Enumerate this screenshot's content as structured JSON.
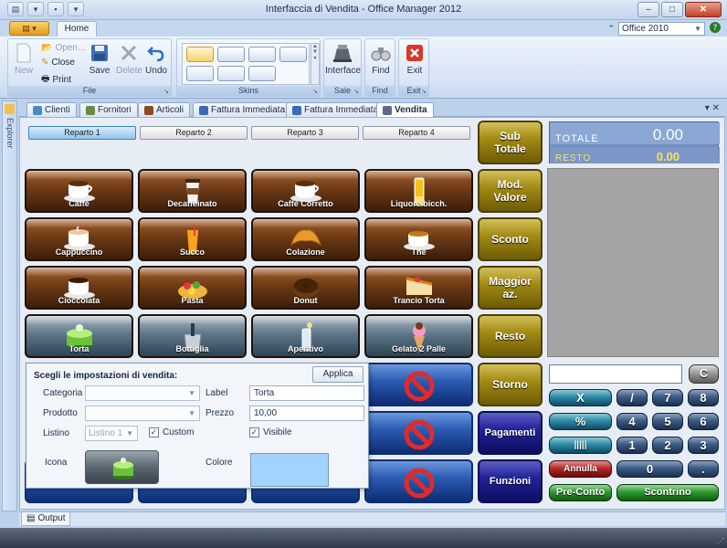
{
  "window": {
    "title": "Interfaccia di Vendita - Office Manager 2012",
    "controls": [
      "–",
      "□",
      "✕"
    ]
  },
  "ribbon": {
    "app_button": "",
    "tab": "Home",
    "skin_selected": "Office 2010",
    "groups": {
      "file": {
        "title": "File",
        "new_label": "New",
        "open_label": "Open...",
        "close_label": "Close",
        "print_label": "Print",
        "save_label": "Save",
        "delete_label": "Delete",
        "undo_label": "Undo"
      },
      "skins": {
        "title": "Skins"
      },
      "sale": {
        "title": "Sale",
        "interface_label": "Interface"
      },
      "find": {
        "title": "Find",
        "find_label": "Find"
      },
      "exit": {
        "title": "Exit",
        "exit_label": "Exit"
      }
    }
  },
  "explorer": {
    "label": "Explorer"
  },
  "doc_tabs": [
    {
      "label": "Clienti",
      "color": "#4a88c8"
    },
    {
      "label": "Fornitori",
      "color": "#6a8a40"
    },
    {
      "label": "Articoli",
      "color": "#8a4a20"
    },
    {
      "label": "Fattura Immediata",
      "color": "#3a6ab8"
    },
    {
      "label": "Fattura Immediata",
      "color": "#3a6ab8"
    },
    {
      "label": "Vendita",
      "color": "#5a6a8a",
      "active": true
    }
  ],
  "reparti": [
    "Reparto 1",
    "Reparto 2",
    "Reparto 3",
    "Reparto 4"
  ],
  "products": [
    {
      "label": "Caffè",
      "icon": "coffee-cup-icon",
      "style": "brown"
    },
    {
      "label": "Decaffeinato",
      "icon": "coffee-takeaway-icon",
      "style": "brown"
    },
    {
      "label": "Caffè Corretto",
      "icon": "coffee-cup-icon",
      "style": "brown"
    },
    {
      "label": "Liquore bicch.",
      "icon": "liqueur-glass-icon",
      "style": "brown"
    },
    {
      "label": "Cappuccino",
      "icon": "cappuccino-icon",
      "style": "brown"
    },
    {
      "label": "Succo",
      "icon": "juice-icon",
      "style": "brown"
    },
    {
      "label": "Colazione",
      "icon": "croissant-icon",
      "style": "brown"
    },
    {
      "label": "Thè",
      "icon": "tea-icon",
      "style": "brown"
    },
    {
      "label": "Cioccolata",
      "icon": "chocolate-cup-icon",
      "style": "brown"
    },
    {
      "label": "Pasta",
      "icon": "pastry-icon",
      "style": "brown"
    },
    {
      "label": "Donut",
      "icon": "donut-icon",
      "style": "brown"
    },
    {
      "label": "Trancio Torta",
      "icon": "cake-slice-icon",
      "style": "brown"
    },
    {
      "label": "Torta",
      "icon": "cake-icon",
      "style": "blue"
    },
    {
      "label": "Bottiglia",
      "icon": "bottle-bucket-icon",
      "style": "blue"
    },
    {
      "label": "Aperitivo",
      "icon": "aperitif-icon",
      "style": "blue"
    },
    {
      "label": "Gelato 2 Palle",
      "icon": "ice-cream-icon",
      "style": "blue"
    }
  ],
  "function_buttons": [
    {
      "label": "Sub\nTotale",
      "style": "gold"
    },
    {
      "label": "Mod.\nValore",
      "style": "gold"
    },
    {
      "label": "Sconto",
      "style": "gold"
    },
    {
      "label": "Maggior\naz.",
      "style": "gold"
    },
    {
      "label": "Resto",
      "style": "gold"
    },
    {
      "label": "Storno",
      "style": "gold"
    },
    {
      "label": "Pagamenti",
      "style": "navy"
    },
    {
      "label": "Funzioni",
      "style": "navy"
    }
  ],
  "display": {
    "total_label": "TOTALE",
    "total_value": "0.00",
    "resto_label": "RESTO",
    "resto_value": "0.00"
  },
  "keypad": {
    "clear": "C",
    "times": "X",
    "percent": "%",
    "barcode": "|||||",
    "annulla": "Annulla",
    "pre_conto": "Pre-Conto",
    "scontrino": "Scontrino",
    "digits": [
      "7",
      "8",
      "9",
      "4",
      "5",
      "6",
      "1",
      "2",
      "3",
      "0",
      "."
    ]
  },
  "settings": {
    "title": "Scegli le impostazioni di vendita:",
    "apply_label": "Applica",
    "categoria_label": "Categoria",
    "prodotto_label": "Prodotto",
    "listino_label": "Listino",
    "listino_value": "Listino 1",
    "custom_label": "Custom",
    "custom_checked": true,
    "label_label": "Label",
    "label_value": "Torta",
    "prezzo_label": "Prezzo",
    "prezzo_value": "10,00",
    "visibile_label": "Visibile",
    "visibile_checked": true,
    "icona_label": "Icona",
    "icona_icon": "cake-icon",
    "colore_label": "Colore",
    "colore_value": "#a2d3ff"
  },
  "output": {
    "label": "Output"
  }
}
